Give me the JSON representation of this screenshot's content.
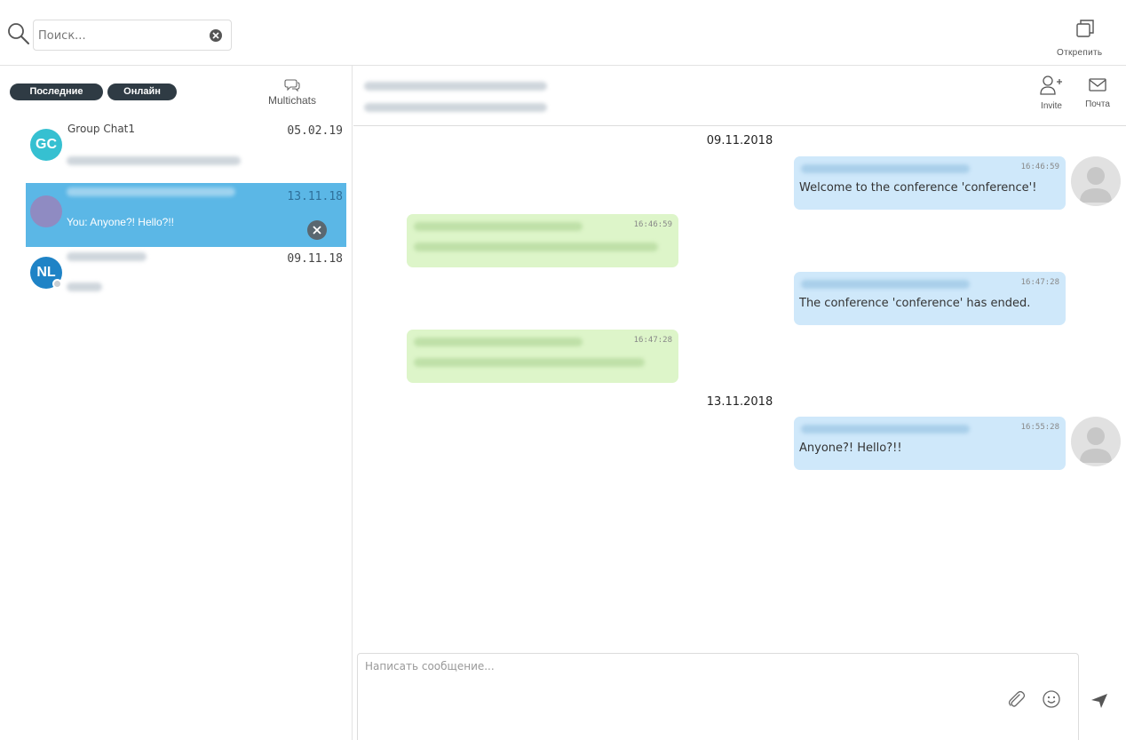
{
  "search": {
    "placeholder": "Поиск..."
  },
  "toolbar": {
    "detach_label": "Открепить",
    "detach_icon": "window-restore-icon"
  },
  "sidebar": {
    "tabs": [
      {
        "label": "Последние",
        "active": true
      },
      {
        "label": "Онлайн",
        "active": false
      }
    ],
    "multichats_label": "Multichats",
    "chats": [
      {
        "initials": "GC",
        "name": "Group Chat1",
        "date": "05.02.19",
        "avatar_color": "#36c0d1",
        "preview": "",
        "active": false
      },
      {
        "initials": "",
        "name": "",
        "date": "13.11.18",
        "avatar_color": "#8f8bc2",
        "preview": "You: Anyone?! Hello?!!",
        "active": true
      },
      {
        "initials": "NL",
        "name": "",
        "date": "09.11.18",
        "avatar_color": "#1f83c6",
        "preview": "",
        "active": false
      }
    ]
  },
  "header": {
    "invite_label": "Invite",
    "mail_label": "Почта"
  },
  "messages": {
    "date_1": "09.11.2018",
    "date_2": "13.11.2018",
    "items": [
      {
        "direction": "out",
        "time": "16:46:59",
        "text": "Welcome to the conference 'conference'!"
      },
      {
        "direction": "in",
        "time": "16:46:59",
        "text": ""
      },
      {
        "direction": "out",
        "time": "16:47:28",
        "text": "The conference 'conference' has ended."
      },
      {
        "direction": "in",
        "time": "16:47:28",
        "text": ""
      },
      {
        "direction": "out",
        "time": "16:55:28",
        "text": "Anyone?! Hello?!!"
      }
    ]
  },
  "composer": {
    "placeholder": "Написать сообщение..."
  },
  "colors": {
    "active_chat": "#5bb7e6",
    "outgoing_bubble": "#cfe8fa",
    "incoming_bubble": "#ddf5c9",
    "pill": "#2f3b44"
  }
}
